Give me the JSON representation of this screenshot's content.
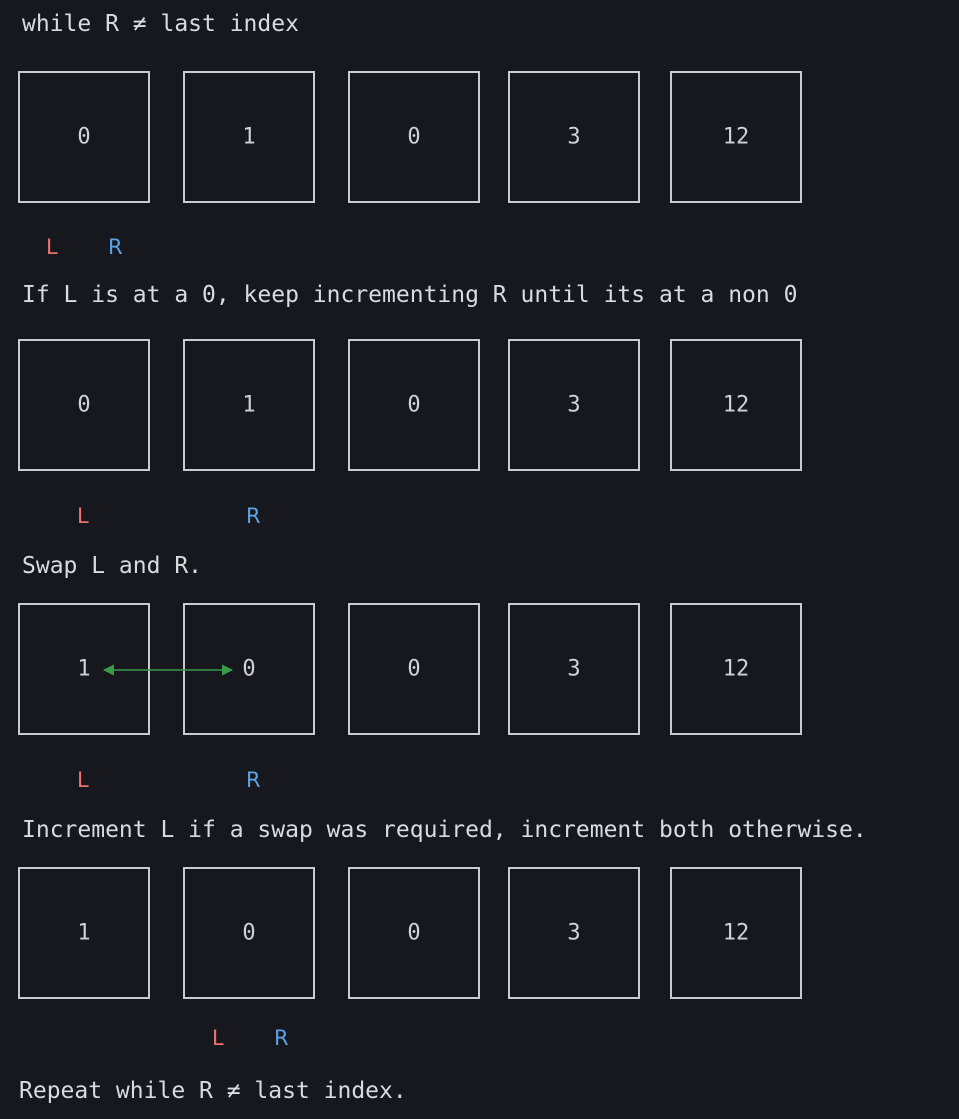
{
  "captions": {
    "c1": "while R ≠ last index",
    "c2": "If L is at a 0, keep incrementing R until its at a non 0",
    "c3": "Swap L and R.",
    "c4": "Increment L if a swap was required, increment both otherwise.",
    "c5": "Repeat while R ≠ last index."
  },
  "rows": [
    {
      "values": [
        "0",
        "1",
        "0",
        "3",
        "12"
      ],
      "pointers": {
        "L": "L",
        "R": "R"
      }
    },
    {
      "values": [
        "0",
        "1",
        "0",
        "3",
        "12"
      ],
      "pointers": {
        "L": "L",
        "R": "R"
      }
    },
    {
      "values": [
        "1",
        "0",
        "0",
        "3",
        "12"
      ],
      "pointers": {
        "L": "L",
        "R": "R"
      }
    },
    {
      "values": [
        "1",
        "0",
        "0",
        "3",
        "12"
      ],
      "pointers": {
        "L": "L",
        "R": "R"
      }
    }
  ],
  "colors": {
    "L": "#f0706e",
    "R": "#5aa3e8",
    "swap_arrow": "#3a9a4a"
  }
}
